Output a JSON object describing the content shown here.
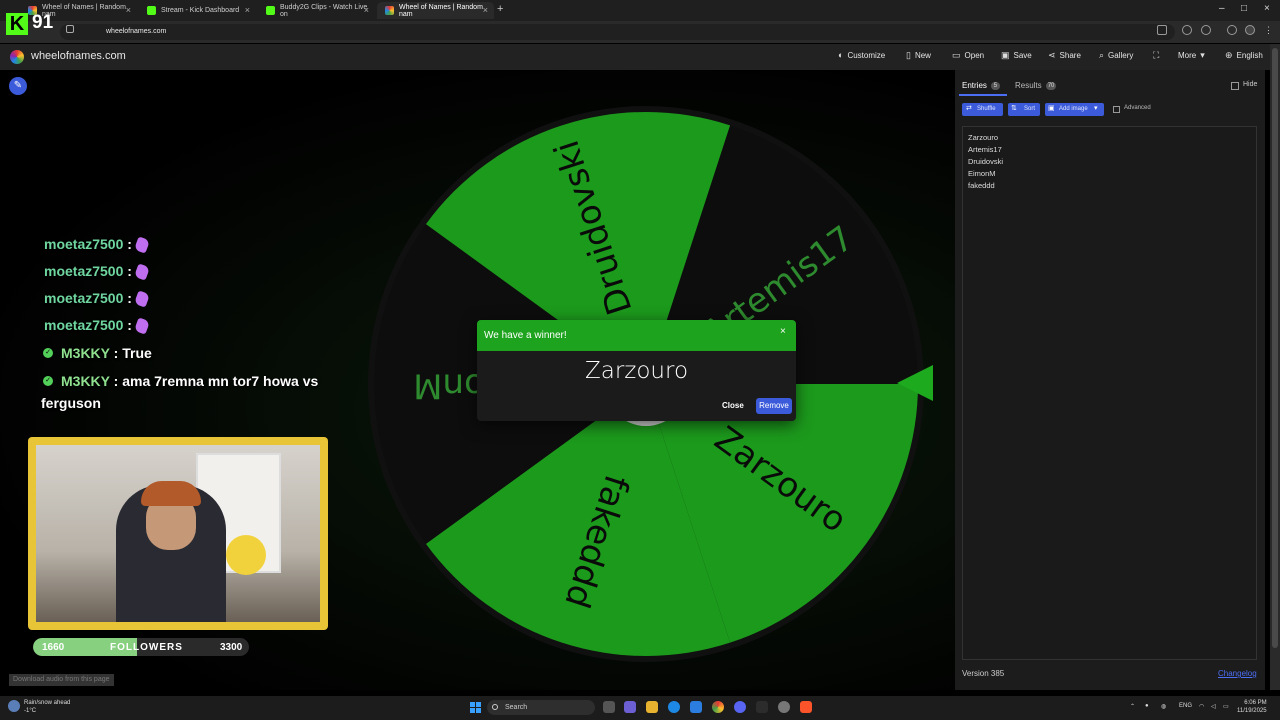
{
  "browser": {
    "tabs": [
      {
        "label": "Wheel of Names | Random nam",
        "active": false
      },
      {
        "label": "Stream - Kick Dashboard",
        "active": false
      },
      {
        "label": "Buddy2G Clips - Watch Live on",
        "active": false
      },
      {
        "label": "Wheel of Names | Random nam",
        "active": true
      }
    ],
    "url": "wheelofnames.com"
  },
  "overlay": {
    "kick_logo": "K",
    "viewer_count": "91"
  },
  "site": {
    "name": "wheelofnames.com",
    "menu": [
      {
        "label": "Customize",
        "icon": "palette-icon"
      },
      {
        "label": "New",
        "icon": "file-icon"
      },
      {
        "label": "Open",
        "icon": "folder-icon"
      },
      {
        "label": "Save",
        "icon": "save-icon"
      },
      {
        "label": "Share",
        "icon": "share-icon"
      },
      {
        "label": "Gallery",
        "icon": "search-icon"
      },
      {
        "label": "",
        "icon": "fullscreen-icon"
      },
      {
        "label": "More",
        "icon": "chevron-down-icon"
      },
      {
        "label": "English",
        "icon": "globe-icon"
      }
    ]
  },
  "wheel": {
    "entries": [
      "Zarzouro",
      "Artemis17",
      "Druidovski",
      "EimonM",
      "fakeddd"
    ],
    "segments": [
      {
        "label": "Artemis17",
        "color": "#0d0d0d"
      },
      {
        "label": "Zarzouro",
        "color": "#1c9a1c"
      },
      {
        "label": "fakeddd",
        "color": "#1c9a1c"
      },
      {
        "label": "EimonM",
        "color": "#0d0d0d"
      },
      {
        "label": "Druidovski",
        "color": "#1c9a1c"
      }
    ],
    "colors": {
      "green": "#1c9a1c",
      "dark": "#0d0d0d"
    }
  },
  "dialog": {
    "title": "We have a winner!",
    "close_icon": "×",
    "winner": "Zarzouro",
    "close_label": "Close",
    "remove_label": "Remove"
  },
  "chat": [
    {
      "user": "moetaz7500",
      "sep": " :",
      "message": "",
      "badge": false
    },
    {
      "user": "moetaz7500",
      "sep": " :",
      "message": "",
      "badge": false
    },
    {
      "user": "moetaz7500",
      "sep": " :",
      "message": "",
      "badge": false
    },
    {
      "user": "moetaz7500",
      "sep": " :",
      "message": "",
      "badge": false
    },
    {
      "user": "M3KKY",
      "sep": " :",
      "message": " True",
      "badge": true
    },
    {
      "user": "M3KKY",
      "sep": " :",
      "message": " ama 7remna mn tor7 howa vs",
      "badge": true
    },
    {
      "user": "",
      "sep": "",
      "message": "ferguson",
      "badge": false
    }
  ],
  "followers": {
    "start": "1660",
    "label": "FOLLOWERS",
    "end": "3300",
    "progress": 0.48
  },
  "download_audio": "Download audio from this page",
  "panel": {
    "tabs": [
      {
        "label": "Entries",
        "count": "5"
      },
      {
        "label": "Results",
        "count": "70"
      }
    ],
    "hide_label": "Hide",
    "buttons": [
      {
        "label": "Shuffle",
        "icon": "shuffle-icon"
      },
      {
        "label": "Sort",
        "icon": "sort-icon"
      },
      {
        "label": "Add image",
        "icon": "image-icon"
      }
    ],
    "advanced_label": "Advanced",
    "entries": [
      "Zarzouro",
      "Artemis17",
      "Druidovski",
      "EimonM",
      "fakeddd"
    ],
    "version": "Version 385",
    "changelog": "Changelog"
  },
  "taskbar": {
    "weather_title": "Rain/snow ahead",
    "weather_temp": "-1°C",
    "search_placeholder": "Search",
    "lang": "ENG",
    "time": "6:06 PM",
    "date": "11/19/2025"
  }
}
